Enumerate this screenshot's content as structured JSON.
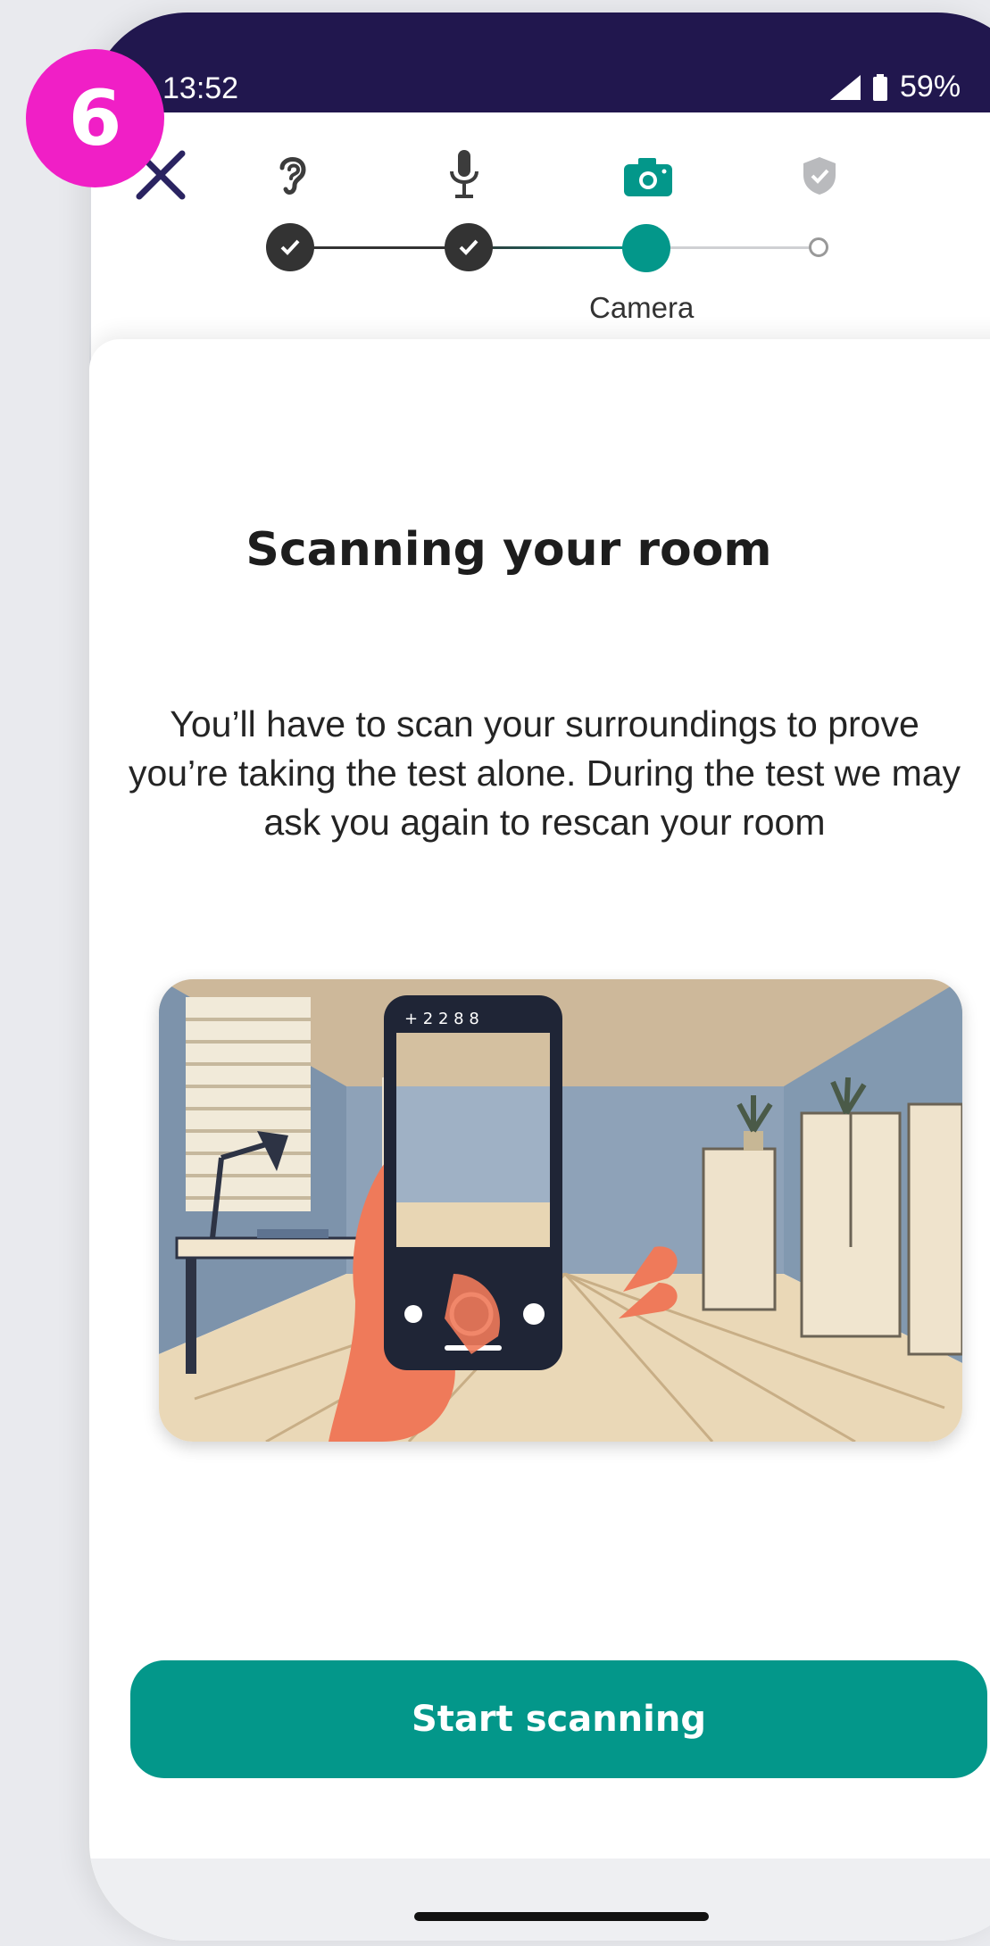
{
  "status_bar": {
    "time": "13:52",
    "battery": "59%"
  },
  "step_badge": "6",
  "stepper": {
    "steps": [
      {
        "icon": "ear-icon",
        "state": "done"
      },
      {
        "icon": "microphone-icon",
        "state": "done"
      },
      {
        "icon": "camera-icon",
        "state": "current",
        "label": "Camera"
      },
      {
        "icon": "shield-check-icon",
        "state": "pending"
      }
    ],
    "current_label": "Camera"
  },
  "content": {
    "title": "Scanning your room",
    "description": "You’ll have to scan your surroundings to prove you’re taking the test alone. During the test we may ask you again to rescan your room"
  },
  "phone_screen": {
    "top_digits": "+  2  2  8  8"
  },
  "buttons": {
    "start_scanning": "Start scanning"
  },
  "colors": {
    "status_bar": "#21174e",
    "accent": "#03978a",
    "badge": "#f01fc6"
  }
}
